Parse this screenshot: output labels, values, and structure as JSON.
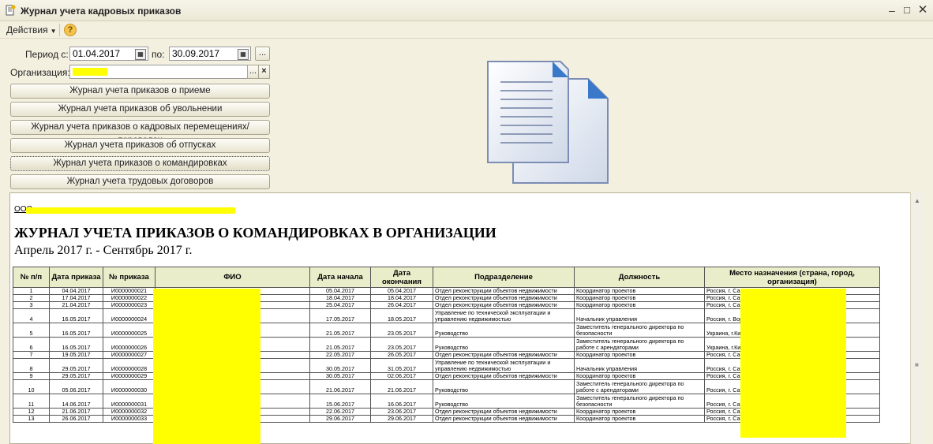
{
  "window": {
    "title": "Журнал учета кадровых приказов"
  },
  "menu": {
    "actions_label": "Действия",
    "help_label": "?"
  },
  "form": {
    "period_from_label": "Период с:",
    "period_from": "01.04.2017",
    "period_to_label": "по:",
    "period_to": "30.09.2017",
    "period_select_label": "...",
    "organization_label": "Организация:",
    "org_select_label": "...",
    "org_clear_label": "×"
  },
  "buttons": [
    {
      "label": "Журнал учета приказов о приеме"
    },
    {
      "label": "Журнал учета приказов об увольнении"
    },
    {
      "label": "Журнал учета приказов о кадровых перемещениях/переводах"
    },
    {
      "label": "Журнал учета приказов об отпусках"
    },
    {
      "label": "Журнал учета приказов о командировках"
    },
    {
      "label": "Журнал учета трудовых договоров"
    }
  ],
  "report": {
    "org_prefix": "ООО",
    "title": "ЖУРНАЛ УЧЕТА ПРИКАЗОВ О КОМАНДИРОВКАХ В ОРГАНИЗАЦИИ",
    "period": "Апрель 2017 г. - Сентябрь 2017 г.",
    "columns": [
      "№ п/п",
      "Дата приказа",
      "№ приказа",
      "ФИО",
      "Дата начала",
      "Дата окончания",
      "Подразделение",
      "Должность",
      "Место назначения (страна, город, организация)"
    ],
    "rows": [
      [
        "1",
        "04.04.2017",
        "И0000000021",
        "",
        "05.04.2017",
        "05.04.2017",
        "Отдел реконструкции объектов недвижимости",
        "Координатор проектов",
        "Россия, г. Са"
      ],
      [
        "2",
        "17.04.2017",
        "И0000000022",
        "",
        "18.04.2017",
        "18.04.2017",
        "Отдел реконструкции объектов недвижимости",
        "Координатор проектов",
        "Россия, г. Са"
      ],
      [
        "3",
        "21.04.2017",
        "И0000000023",
        "",
        "25.04.2017",
        "26.04.2017",
        "Отдел реконструкции объектов недвижимости",
        "Координатор проектов",
        "Россия, г. Са"
      ],
      [
        "4",
        "16.05.2017",
        "И0000000024",
        "",
        "17.05.2017",
        "18.05.2017",
        "Управление по технической эксплуатации и управлению недвижимостью",
        "Начальник управления",
        "Россия, г. Вор"
      ],
      [
        "5",
        "16.05.2017",
        "И0000000025",
        "",
        "21.05.2017",
        "23.05.2017",
        "Руководство",
        "Заместитель генерального директора по безопасности",
        "Украина, г.Ки"
      ],
      [
        "6",
        "16.05.2017",
        "И0000000026",
        "",
        "21.05.2017",
        "23.05.2017",
        "Руководство",
        "Заместитель генерального директора по работе с арендаторами",
        "Украина, г.Ки"
      ],
      [
        "7",
        "19.05.2017",
        "И0000000027",
        "",
        "22.05.2017",
        "26.05.2017",
        "Отдел реконструкции объектов недвижимости",
        "Координатор проектов",
        "Россия, г. Са"
      ],
      [
        "8",
        "29.05.2017",
        "И0000000028",
        "",
        "30.05.2017",
        "31.05.2017",
        "Управление по технической эксплуатации и управлению недвижимостью",
        "Начальник управления",
        "Россия, г. Са"
      ],
      [
        "9",
        "29.05.2017",
        "И0000000029",
        "",
        "30.05.2017",
        "02.06.2017",
        "Отдел реконструкции объектов недвижимости",
        "Координатор проектов",
        "Россия, г. Са"
      ],
      [
        "10",
        "05.06.2017",
        "И0000000030",
        "",
        "21.06.2017",
        "21.06.2017",
        "Руководство",
        "Заместитель генерального директора по работе с арендаторами",
        "Россия, г. Са"
      ],
      [
        "11",
        "14.06.2017",
        "И0000000031",
        "",
        "15.06.2017",
        "16.06.2017",
        "Руководство",
        "Заместитель генерального директора по безопасности",
        "Россия, г. Са"
      ],
      [
        "12",
        "21.06.2017",
        "И0000000032",
        "",
        "22.06.2017",
        "23.06.2017",
        "Отдел реконструкции объектов недвижимости",
        "Координатор проектов",
        "Россия, г. Са"
      ],
      [
        "13",
        "26.06.2017",
        "И0000000033",
        "",
        "29.06.2017",
        "29.06.2017",
        "Отдел реконструкции объектов недвижимости",
        "Координатор проектов",
        "Россия, г. Са"
      ]
    ]
  },
  "colors": {
    "highlight": "#ffff00",
    "header_bg": "#e9edc9",
    "window_bg": "#f4f0e0"
  },
  "icons": [
    "app-icon",
    "calendar-icon",
    "documents-icon",
    "help-icon"
  ]
}
